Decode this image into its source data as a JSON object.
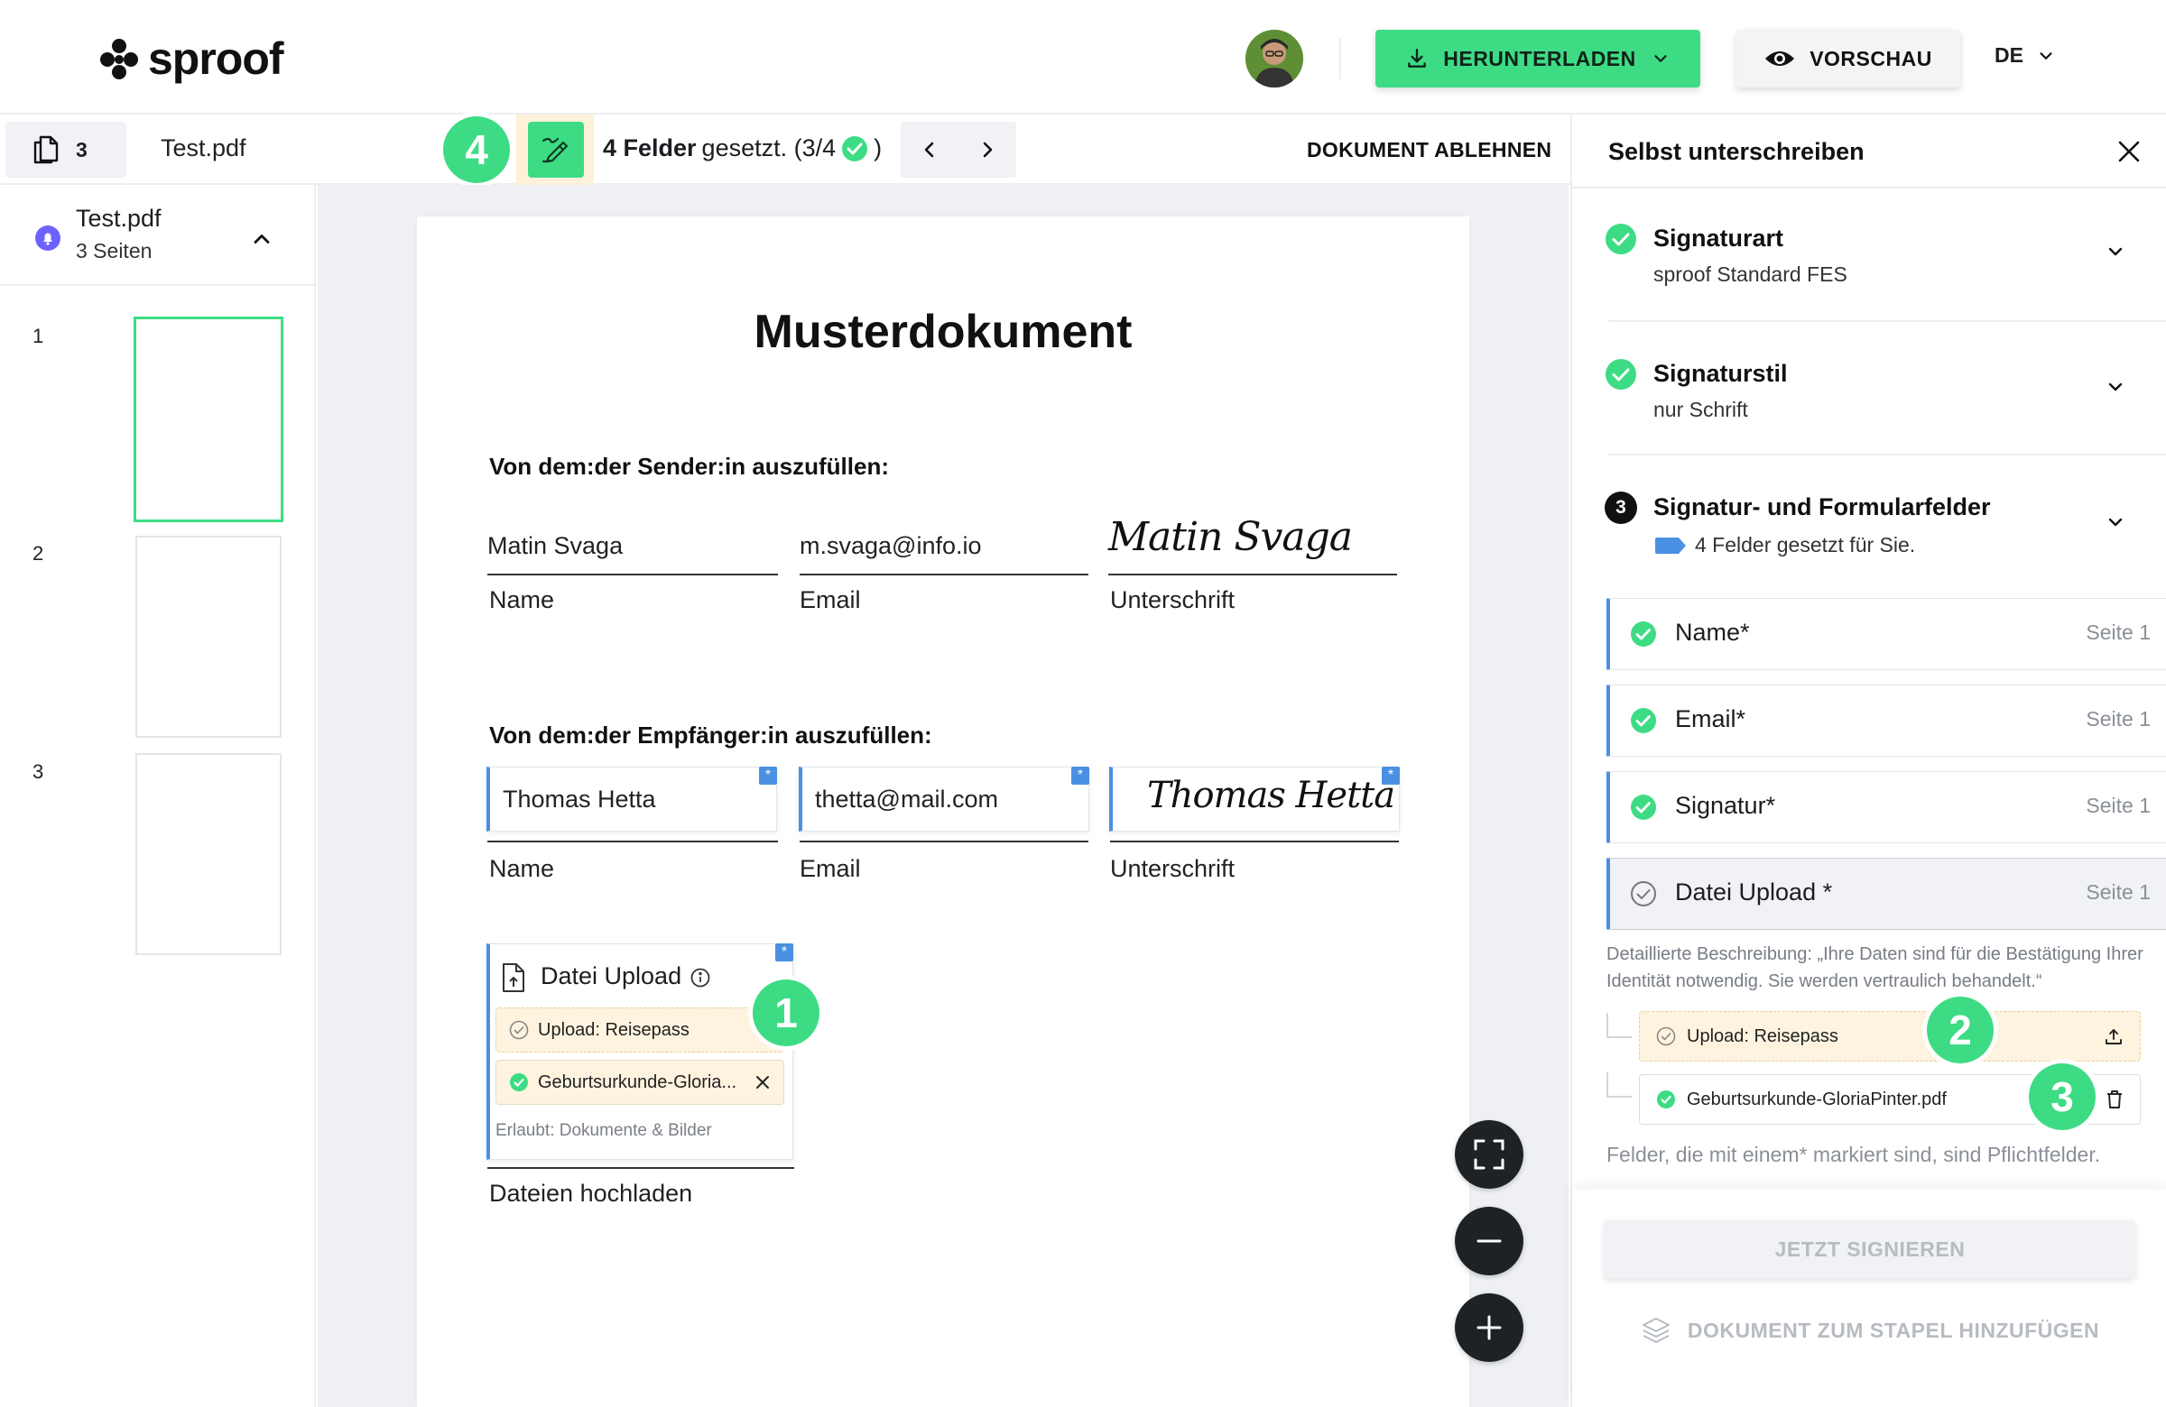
{
  "header": {
    "logo_text": "sproof",
    "download_label": "HERUNTERLADEN",
    "preview_label": "VORSCHAU",
    "language": "DE"
  },
  "toolbar": {
    "page_count": "3",
    "document_name": "Test.pdf",
    "badge_4": "4",
    "fields_bold": "4 Felder",
    "fields_rest": "gesetzt. (3/4",
    "fields_close": ")",
    "decline_label": "DOKUMENT ABLEHNEN"
  },
  "sidebar": {
    "document_title": "Test.pdf",
    "document_pages": "3 Seiten",
    "thumbnails": [
      "1",
      "2",
      "3"
    ]
  },
  "document": {
    "title": "Musterdokument",
    "sender_section": "Von dem:der Sender:in auszufüllen:",
    "sender": {
      "name_value": "Matin Svaga",
      "email_value": "m.svaga@info.io",
      "signature_value": "Matin Svaga",
      "name_label": "Name",
      "email_label": "Email",
      "signature_label": "Unterschrift"
    },
    "recipient_section": "Von dem:der Empfänger:in auszufüllen:",
    "recipient": {
      "name_value": "Thomas Hetta",
      "email_value": "thetta@mail.com",
      "signature_value": "Thomas Hetta",
      "name_label": "Name",
      "email_label": "Email",
      "signature_label": "Unterschrift"
    },
    "required_marker": "*",
    "upload": {
      "title": "Datei Upload",
      "pending_chip": "Upload: Reisepass",
      "done_chip": "Geburtsurkunde-Gloria...",
      "allowed": "Erlaubt: Dokumente & Bilder",
      "label": "Dateien hochladen",
      "badge_1": "1"
    }
  },
  "panel": {
    "title": "Selbst unterschreiben",
    "steps": [
      {
        "title": "Signaturart",
        "subtitle": "sproof Standard FES"
      },
      {
        "title": "Signaturstil",
        "subtitle": "nur Schrift"
      },
      {
        "number": "3",
        "title": "Signatur- und Formularfelder",
        "subtitle": "4 Felder gesetzt für Sie."
      }
    ],
    "fields": [
      {
        "name": "Name*",
        "page": "Seite 1"
      },
      {
        "name": "Email*",
        "page": "Seite 1"
      },
      {
        "name": "Signatur*",
        "page": "Seite 1"
      },
      {
        "name": "Datei Upload *",
        "page": "Seite 1"
      }
    ],
    "description": "Detaillierte Beschreibung: „Ihre Daten sind für die Bestätigung Ihrer Identität notwendig. Sie werden vertraulich behandelt.“",
    "upload_pending": "Upload: Reisepass",
    "upload_done": "Geburtsurkunde-GloriaPinter.pdf",
    "badge_2": "2",
    "badge_3": "3",
    "required_note": "Felder, die mit einem* markiert sind, sind Pflichtfelder.",
    "sign_label": "JETZT SIGNIEREN",
    "stack_label": "DOKUMENT ZUM STAPEL HINZUFÜGEN"
  },
  "colors": {
    "accent_green": "#3ddc84",
    "field_blue": "#4a90e2",
    "pending_yellow": "#fdf3df"
  }
}
